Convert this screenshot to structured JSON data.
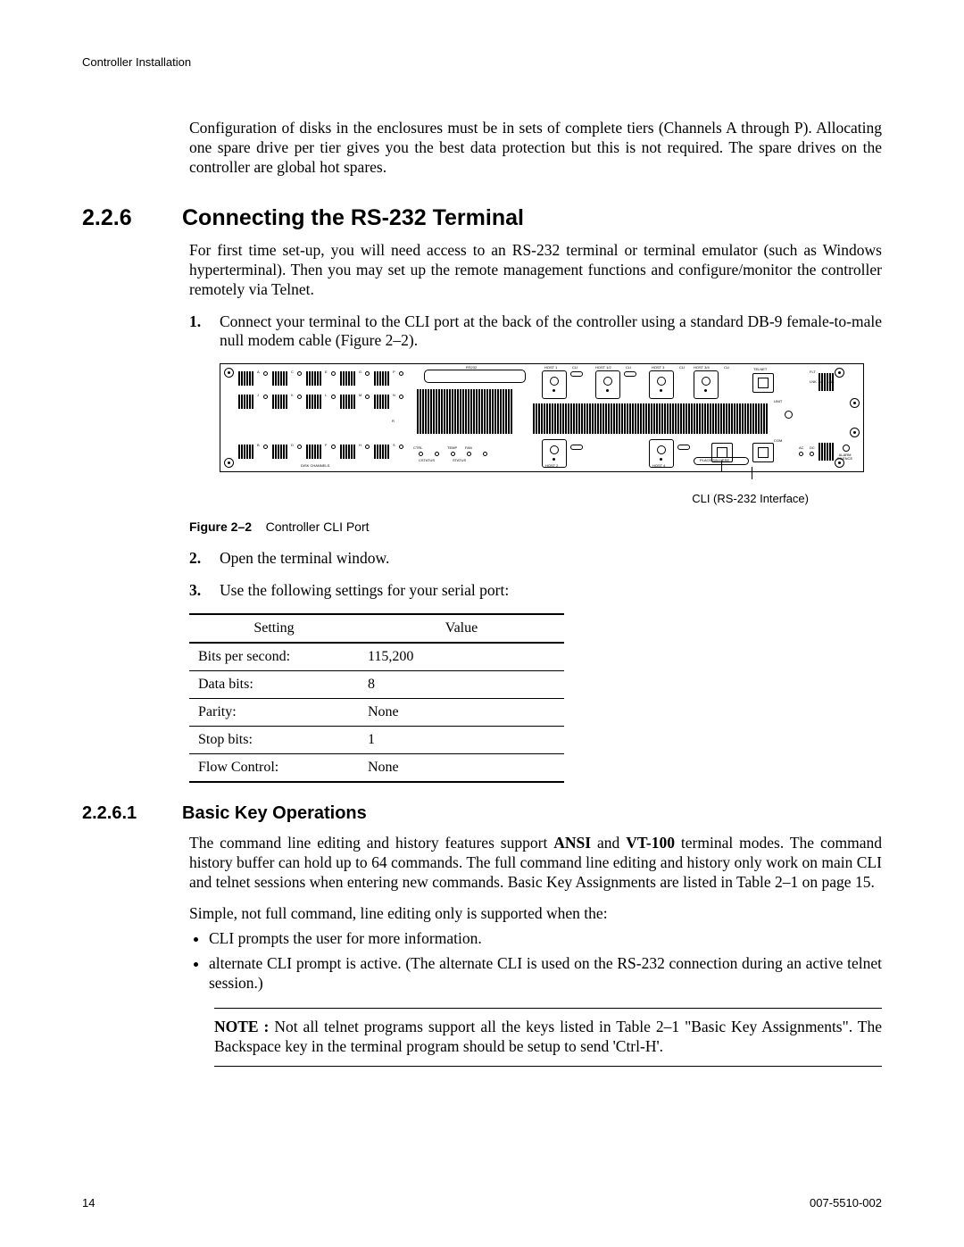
{
  "runningHead": "Controller Installation",
  "introPara": "Configuration of disks in the enclosures must be in sets of complete tiers (Channels A through P). Allocating one spare drive per tier gives you the best data protection but this is not required. The spare drives on the controller are global hot spares.",
  "section": {
    "num": "2.2.6",
    "title": "Connecting the RS-232 Terminal"
  },
  "sectionIntro": "For first time set-up, you will need access to an RS-232 terminal or terminal emulator (such as Windows hyperterminal). Then you may set up the remote management functions and configure/monitor the controller remotely via Telnet.",
  "steps": [
    {
      "n": "1.",
      "t": "Connect your terminal to the CLI port at the back of the controller using a standard DB-9 female-to-male null modem cable (Figure 2–2)."
    },
    {
      "n": "2.",
      "t": "Open the terminal window."
    },
    {
      "n": "3.",
      "t": "Use the following settings for your serial port:"
    }
  ],
  "figure": {
    "callout": "CLI (RS-232 Interface)",
    "labelBold": "Figure 2–2",
    "labelRest": "Controller CLI Port",
    "panelLabels": {
      "rs232": "RS232",
      "host1": "HOST 1",
      "cli": "CLI",
      "host12": "HOST 1/2",
      "cli2": "CLI",
      "host3": "HOST 3",
      "cli3": "CLI",
      "host34": "HOST 3/4",
      "cli4": "CLI",
      "telnet": "TELNET",
      "unit": "UNIT",
      "com": "COM",
      "host2": "HOST 2",
      "host4": "HOST 4",
      "alarm": "ALARM\nSILENCE",
      "diskChannels": "DISK CHANNELS",
      "ctrl": "CTRL",
      "cstatus": "CSTATUS",
      "temp": "TEMP",
      "fan": "FAN",
      "status": "STATUS",
      "links": "LNK  ACT  LNK",
      "ac": "AC",
      "dc": "DC",
      "placeSn": "PLACE S/N HERE",
      "flt": "FLT",
      "a": "A",
      "b": "B",
      "c": "C",
      "d": "D",
      "e": "E",
      "f": "F",
      "g": "G",
      "h": "H",
      "j": "J",
      "k": "K",
      "l": "L",
      "m": "M",
      "n": "N",
      "p": "P",
      "r": "R",
      "s": "S"
    }
  },
  "settingsTable": {
    "headers": [
      "Setting",
      "Value"
    ],
    "rows": [
      [
        "Bits per second:",
        "115,200"
      ],
      [
        "Data bits:",
        "8"
      ],
      [
        "Parity:",
        "None"
      ],
      [
        "Stop bits:",
        "1"
      ],
      [
        "Flow Control:",
        "None"
      ]
    ]
  },
  "subsection": {
    "num": "2.2.6.1",
    "title": "Basic Key Operations"
  },
  "subPara1a": "The command line editing and history features support ",
  "subPara1b": "ANSI",
  "subPara1c": " and ",
  "subPara1d": "VT-100",
  "subPara1e": " terminal modes. The command history buffer can hold up to 64 commands. The full command line editing and history only work on main CLI and telnet sessions when entering new commands. Basic Key Assignments are listed in Table 2–1 on page 15.",
  "subPara2": "Simple, not full command, line editing only is supported when the:",
  "bullets": [
    "CLI prompts the user for more information.",
    "alternate CLI prompt is active. (The alternate CLI is used on the RS-232 connection during an active telnet session.)"
  ],
  "note": {
    "label": "NOTE :",
    "text": "  Not all telnet programs support all  the keys listed in  Table 2–1 \"Basic Key Assignments\". The Backspace key in the terminal program should be setup to send 'Ctrl-H'."
  },
  "footer": {
    "page": "14",
    "docnum": "007-5510-002"
  }
}
